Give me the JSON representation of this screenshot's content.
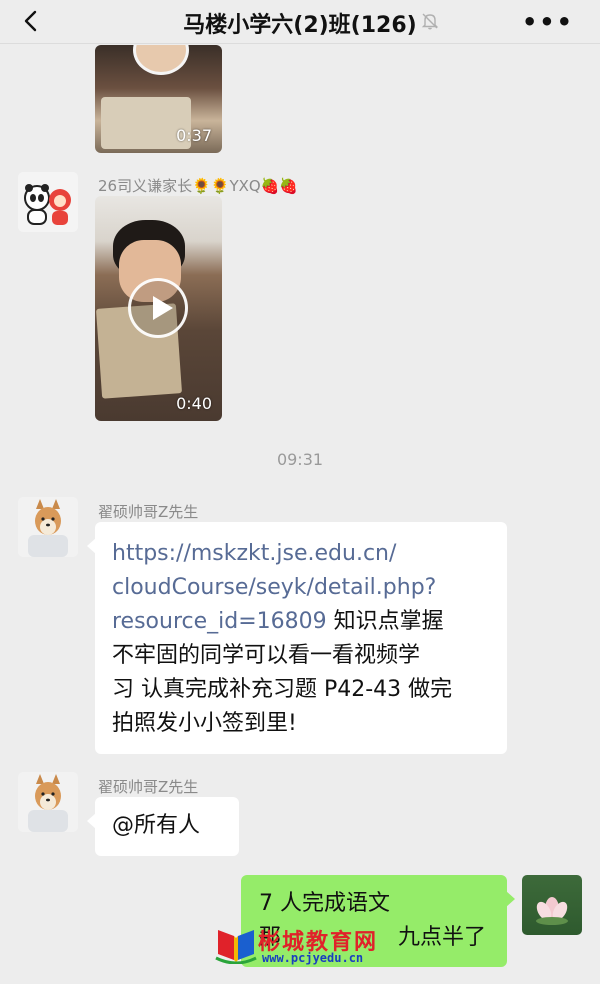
{
  "header": {
    "title": "马楼小学六(2)班(126)",
    "more_label": "•••"
  },
  "messages": {
    "video1": {
      "duration": "0:37"
    },
    "video2": {
      "sender": "26司义谦家长🌻🌻YXQ🍓🍓",
      "duration": "0:40"
    },
    "time_separator": "09:31",
    "text1": {
      "sender": "翟硕帅哥Z先生",
      "link_line1": "https://mskzkt.jse.edu.cn/",
      "link_line2": "cloudCourse/seyk/detail.php?",
      "link_line3": "resource_id=16809",
      "text_line3_tail": " 知识点掌握",
      "text_line4": "不牢固的同学可以看一看视频学",
      "text_line5": "习 认真完成补充习题 P42-43 做完",
      "text_line6": "拍照发小小签到里!"
    },
    "text2": {
      "sender": "翟硕帅哥Z先生",
      "text": "@所有人"
    },
    "mine": {
      "line1": "7 人完成语文",
      "line2_head": "那",
      "line2_tail": " 九点半了"
    }
  },
  "watermark": {
    "text": "彬城教育网",
    "url": "www.pcjyedu.cn"
  },
  "colors": {
    "my_bubble": "#95ec69",
    "link": "#576b95",
    "background": "#ededed"
  }
}
